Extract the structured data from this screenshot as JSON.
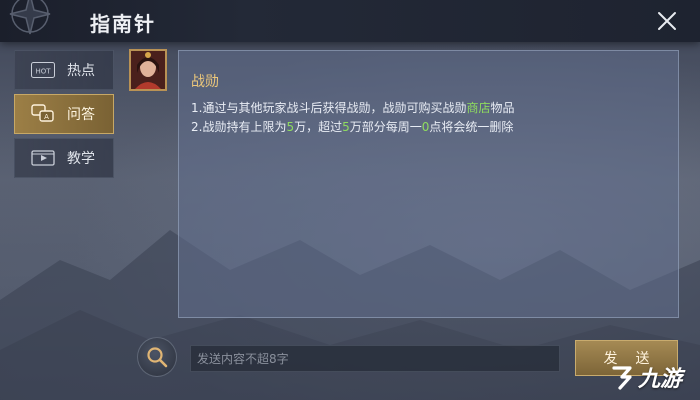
{
  "header": {
    "title": "指南针"
  },
  "tabs": [
    {
      "label": "热点",
      "icon": "hot-icon",
      "active": false
    },
    {
      "label": "问答",
      "icon": "chat-icon",
      "active": true
    },
    {
      "label": "教学",
      "icon": "video-icon",
      "active": false
    }
  ],
  "message": {
    "title": "战勋",
    "line1": {
      "pre": "1.通过与其他玩家战斗后获得战勋，战勋可购买战勋",
      "highlight": "商店",
      "post": "物品"
    },
    "line2": {
      "p1": "2.战勋持有上限为",
      "n1": "5",
      "p2": "万，超过",
      "n2": "5",
      "p3": "万部分每周一",
      "n3": "0",
      "p4": "点将会统一删除"
    }
  },
  "input": {
    "placeholder": "发送内容不超8字",
    "value": ""
  },
  "send_button": {
    "label": "发送"
  },
  "tab_hot_badge": "HOT",
  "watermark": {
    "text": "九游"
  },
  "colors": {
    "accent_gold": "#9c7f46",
    "title_gold": "#ecc77a",
    "highlight_green": "#8fdc5f"
  }
}
